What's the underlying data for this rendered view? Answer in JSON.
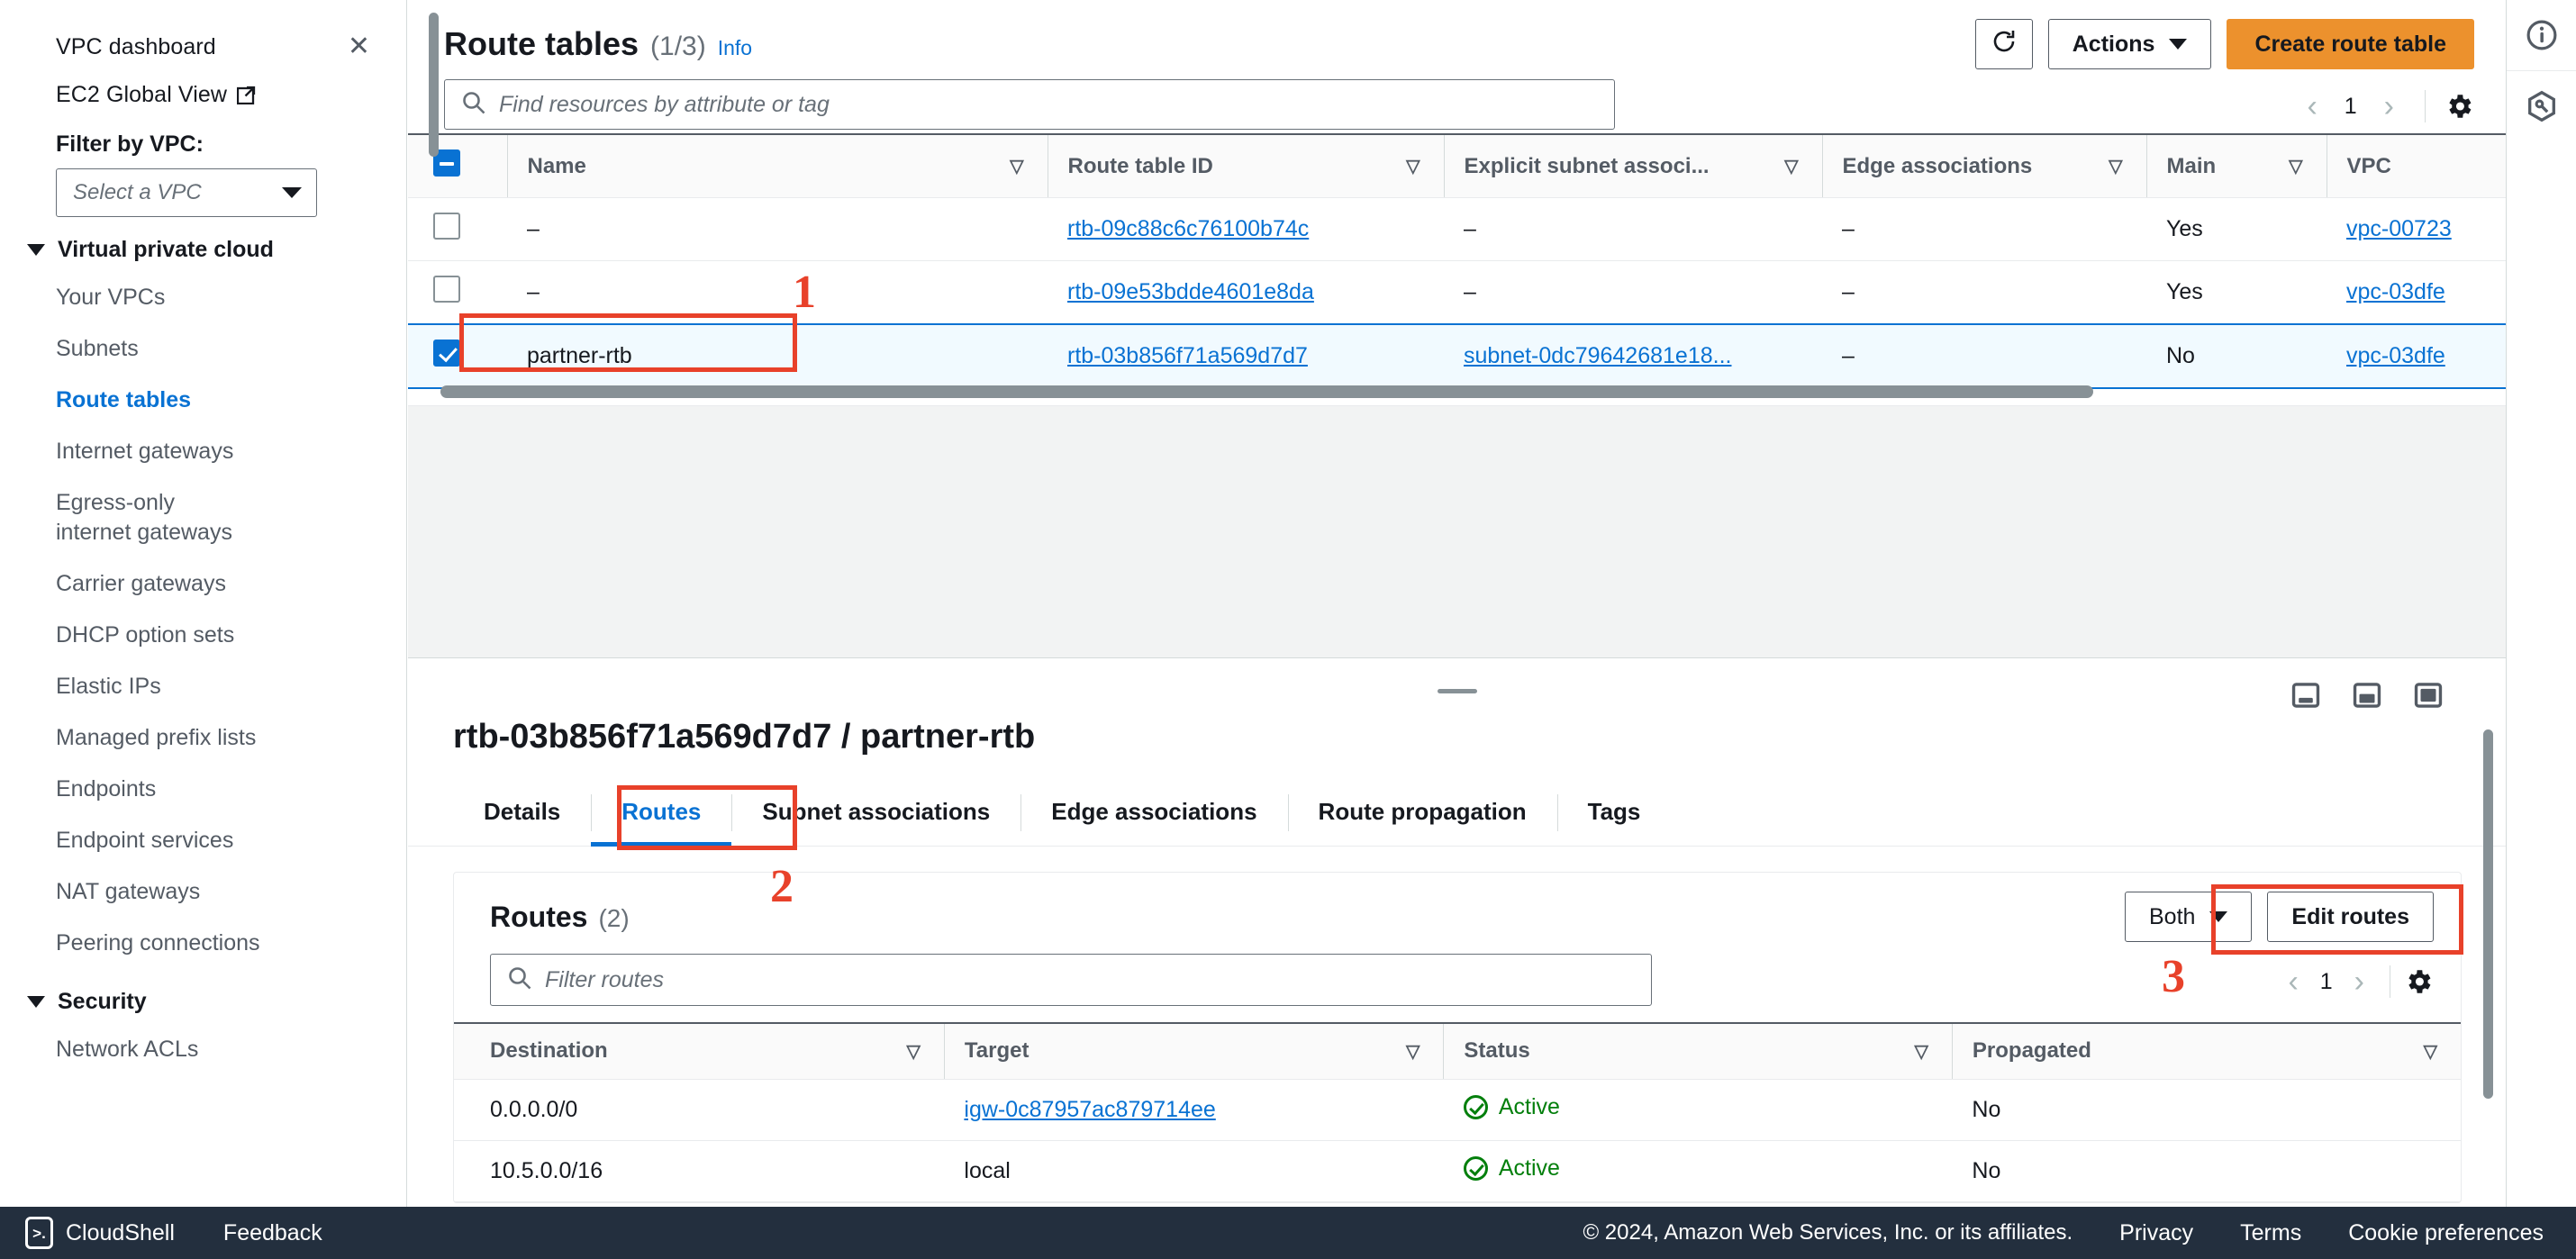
{
  "sidebar": {
    "dashboard_link": "VPC dashboard",
    "global_view_link": "EC2 Global View",
    "close_icon": "close-icon",
    "external_icon": "external-link-icon",
    "filter_label": "Filter by VPC:",
    "vpc_select_placeholder": "Select a VPC",
    "groups": [
      {
        "label": "Virtual private cloud",
        "items": [
          "Your VPCs",
          "Subnets",
          "Route tables",
          "Internet gateways",
          "Egress-only internet gateways",
          "Carrier gateways",
          "DHCP option sets",
          "Elastic IPs",
          "Managed prefix lists",
          "Endpoints",
          "Endpoint services",
          "NAT gateways",
          "Peering connections"
        ],
        "active": "Route tables"
      },
      {
        "label": "Security",
        "items": [
          "Network ACLs"
        ],
        "active": ""
      }
    ]
  },
  "route_tables_panel": {
    "title": "Route tables",
    "count": "(1/3)",
    "info": "Info",
    "refresh_icon": "refresh-icon",
    "actions_label": "Actions",
    "create_label": "Create route table",
    "search_placeholder": "Find resources by attribute or tag",
    "pagination": {
      "page": "1",
      "prev_icon": "chevron-left-icon",
      "next_icon": "chevron-right-icon",
      "settings_icon": "gear-icon"
    },
    "columns": [
      "Name",
      "Route table ID",
      "Explicit subnet associ...",
      "Edge associations",
      "Main",
      "VPC"
    ],
    "rows": [
      {
        "selected": false,
        "name": "–",
        "route_table_id": "rtb-09c88c6c76100b74c",
        "explicit_subnet": "–",
        "edge_associations": "–",
        "main": "Yes",
        "vpc": "vpc-00723"
      },
      {
        "selected": false,
        "name": "–",
        "route_table_id": "rtb-09e53bdde4601e8da",
        "explicit_subnet": "–",
        "edge_associations": "–",
        "main": "Yes",
        "vpc": "vpc-03dfe"
      },
      {
        "selected": true,
        "name": "partner-rtb",
        "route_table_id": "rtb-03b856f71a569d7d7",
        "explicit_subnet": "subnet-0dc79642681e18...",
        "edge_associations": "–",
        "main": "No",
        "vpc": "vpc-03dfe"
      }
    ]
  },
  "detail_panel": {
    "title": "rtb-03b856f71a569d7d7 / partner-rtb",
    "panel_icons": [
      "collapse-panel-icon",
      "split-panel-icon",
      "maximize-panel-icon"
    ],
    "tabs": [
      {
        "label": "Details",
        "active": false
      },
      {
        "label": "Routes",
        "active": true
      },
      {
        "label": "Subnet associations",
        "active": false
      },
      {
        "label": "Edge associations",
        "active": false
      },
      {
        "label": "Route propagation",
        "active": false
      },
      {
        "label": "Tags",
        "active": false
      }
    ],
    "routes": {
      "title": "Routes",
      "count": "(2)",
      "filter_placeholder": "Filter routes",
      "type_filter": "Both",
      "edit_label": "Edit routes",
      "pagination": {
        "page": "1",
        "prev_icon": "chevron-left-icon",
        "next_icon": "chevron-right-icon",
        "settings_icon": "gear-icon"
      },
      "columns": [
        "Destination",
        "Target",
        "Status",
        "Propagated"
      ],
      "rows": [
        {
          "destination": "0.0.0.0/0",
          "target": "igw-0c87957ac879714ee",
          "target_is_link": true,
          "status": "Active",
          "propagated": "No"
        },
        {
          "destination": "10.5.0.0/16",
          "target": "local",
          "target_is_link": false,
          "status": "Active",
          "propagated": "No"
        }
      ]
    }
  },
  "right_rail": {
    "icons": [
      "info-icon",
      "shortcut-icon"
    ]
  },
  "footer": {
    "cloudshell": "CloudShell",
    "cloudshell_glyph": ">.",
    "feedback": "Feedback",
    "copyright": "© 2024, Amazon Web Services, Inc. or its affiliates.",
    "links": [
      "Privacy",
      "Terms",
      "Cookie preferences"
    ]
  },
  "annotations": {
    "markers": [
      {
        "number": "1"
      },
      {
        "number": "2"
      },
      {
        "number": "3"
      }
    ],
    "color": "#e8412a"
  }
}
